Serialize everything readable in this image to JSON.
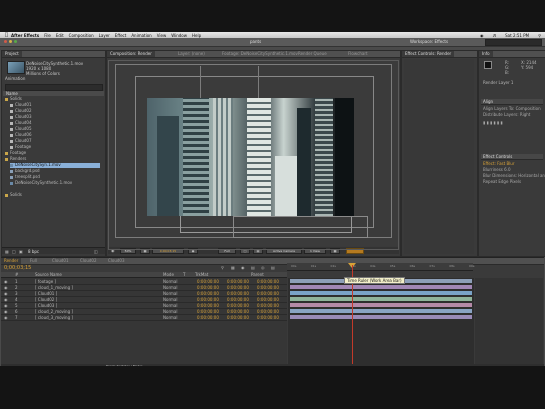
{
  "menubar": {
    "app": "After Effects",
    "items": [
      "File",
      "Edit",
      "Composition",
      "Layer",
      "Effect",
      "Animation",
      "View",
      "Window",
      "Help"
    ],
    "clock": "Sat 2:51 PM"
  },
  "app_title": "pants",
  "panels": {
    "project": {
      "tab": "Project",
      "info_name": "DeNoiseCitySynthetic.1.mov",
      "info_detail1": "1920 x 1080",
      "info_detail2": "Millions of Colors",
      "info_detail3": "Animation",
      "tree": [
        "Solids",
        "Cloud01",
        "Cloud02",
        "Cloud03",
        "Cloud04",
        "Cloud05",
        "Cloud06",
        "Cloud07",
        "Footage",
        "Renders",
        "DeNoiseCitySyn.1.mov",
        "backgrd.psd",
        "treesplit.psd",
        "DeNoiseCitySynthetic.1.mov"
      ],
      "footer_label": "8 bpc"
    },
    "composition": {
      "tab": "Composition: Render",
      "sub_tab": "Render",
      "other_tabs": [
        "Layer: (none)",
        "Footage: DeNoiseCitySynthetic.1.mov",
        "Render Queue",
        "Flowchart"
      ],
      "footer": [
        "50%",
        "0;00;03;15",
        "Full",
        "Active Camera",
        "1 View"
      ]
    },
    "right_panel": {
      "tab": "Effect Controls: Render",
      "sections": [
        "Preview",
        "Text",
        "Effects & Presets"
      ]
    },
    "far_right": {
      "tab": "Workspace: Effects",
      "info_tab": "Info",
      "values": [
        "R: ",
        "G: ",
        "B: ",
        "A: 0",
        "X: 2144",
        "Y: 594"
      ],
      "layer_label": "Render Layer 1",
      "align_tab": "Align",
      "align_rows": [
        "Align Layers To: Composition",
        "Distribute Layers: Right"
      ],
      "para_tab": "Paragraph",
      "effects_tab": "Effect Controls",
      "effects_rows": [
        "Effect: Fast Blur",
        "Blurriness 6.0",
        "Blur Dimensions: Horizontal and Vertical",
        "Repeat Edge Pixels"
      ]
    }
  },
  "timeline": {
    "timecode": "0;00;03;15",
    "tabs": [
      "Render",
      "Full",
      "Cloud01",
      "Cloud02",
      "Cloud03"
    ],
    "headers": [
      "#",
      "Source Name",
      "Mode",
      "T",
      "TrkMat",
      "Parent"
    ],
    "layers": [
      {
        "num": "1",
        "name": "[ footage ]",
        "mode": "Normal",
        "val": "0:00:00:00"
      },
      {
        "num": "2",
        "name": "[ cloud_1_moving ]",
        "mode": "Normal",
        "val": "0:00:00:00"
      },
      {
        "num": "3",
        "name": "[ Cloud01 ]",
        "mode": "Normal",
        "val": "0:00:00:00"
      },
      {
        "num": "4",
        "name": "[ Cloud02 ]",
        "mode": "Normal",
        "val": "0:00:00:00"
      },
      {
        "num": "5",
        "name": "[ Cloud03 ]",
        "mode": "Normal",
        "val": "0:00:00:00"
      },
      {
        "num": "6",
        "name": "[ cloud_2_moving ]",
        "mode": "Normal",
        "val": "0:00:00:00"
      },
      {
        "num": "7",
        "name": "[ cloud_3_moving ]",
        "mode": "Normal",
        "val": "0:00:00:00"
      }
    ],
    "ruler_ticks": [
      "00s",
      "01s",
      "02s",
      "03s",
      "04s",
      "05s",
      "06s",
      "07s",
      "08s",
      "09s"
    ],
    "tooltip": "Time Ruler (Work Area Bar)",
    "footer": "Toggle Switches / Modes",
    "bar_colors": [
      "#8d9fb8",
      "#a187b5",
      "#7aa3c7",
      "#8fb39a",
      "#b58aa8",
      "#8aa4c4",
      "#9a8bb8"
    ]
  }
}
